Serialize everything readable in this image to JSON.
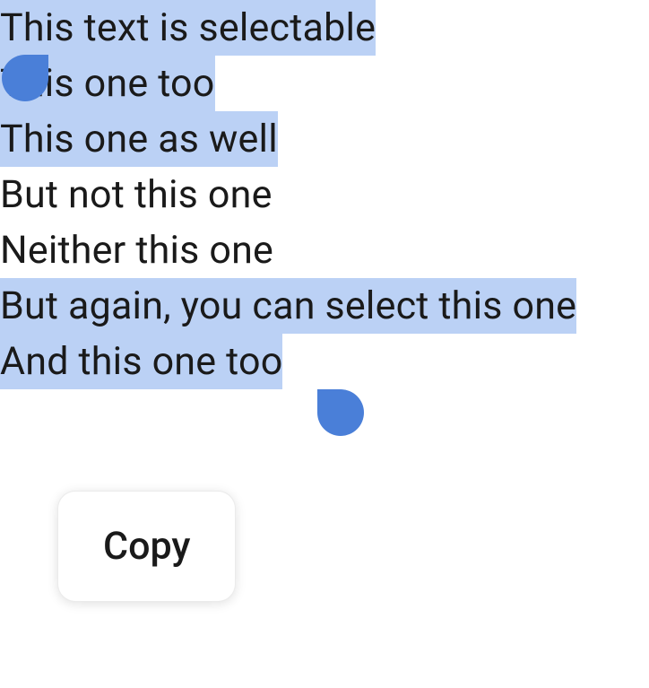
{
  "lines": [
    {
      "text": "This text is selectable",
      "highlighted": true
    },
    {
      "text": "This one too",
      "highlighted": true
    },
    {
      "text": "This one as well",
      "highlighted": true
    },
    {
      "text": "But not this one",
      "highlighted": false
    },
    {
      "text": "Neither this one",
      "highlighted": false
    },
    {
      "text": "But again, you can select this one",
      "highlighted": true
    },
    {
      "text": "And this one too",
      "highlighted": true
    }
  ],
  "tooltip": {
    "copy_label": "Copy"
  },
  "colors": {
    "highlight": "#bbd1f5",
    "handle": "#4a7fd8"
  }
}
